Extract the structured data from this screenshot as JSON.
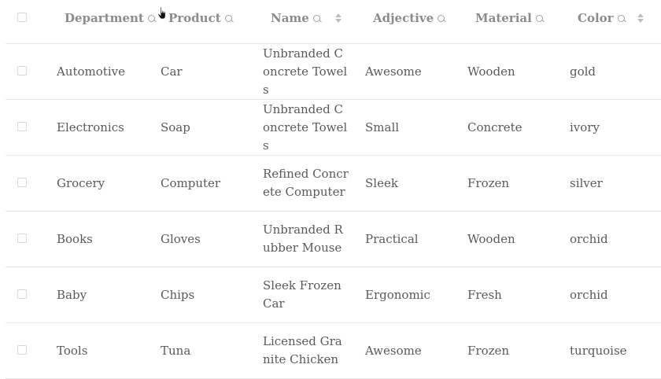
{
  "header": {
    "columns": [
      {
        "key": "department",
        "label": "Department",
        "searchable": true,
        "sortable": false
      },
      {
        "key": "product",
        "label": "Product",
        "searchable": true,
        "sortable": false
      },
      {
        "key": "name",
        "label": "Name",
        "searchable": true,
        "sortable": true
      },
      {
        "key": "adjective",
        "label": "Adjective",
        "searchable": true,
        "sortable": false
      },
      {
        "key": "material",
        "label": "Material",
        "searchable": true,
        "sortable": false
      },
      {
        "key": "color",
        "label": "Color",
        "searchable": true,
        "sortable": true
      }
    ]
  },
  "rows": [
    {
      "department": "Automotive",
      "product": "Car",
      "name": "Unbranded Concrete Towels",
      "adjective": "Awesome",
      "material": "Wooden",
      "color": "gold"
    },
    {
      "department": "Electronics",
      "product": "Soap",
      "name": "Unbranded Concrete Towels",
      "adjective": "Small",
      "material": "Concrete",
      "color": "ivory"
    },
    {
      "department": "Grocery",
      "product": "Computer",
      "name": "Refined Concrete Computer",
      "adjective": "Sleek",
      "material": "Frozen",
      "color": "silver"
    },
    {
      "department": "Books",
      "product": "Gloves",
      "name": "Unbranded Rubber Mouse",
      "adjective": "Practical",
      "material": "Wooden",
      "color": "orchid"
    },
    {
      "department": "Baby",
      "product": "Chips",
      "name": "Sleek Frozen Car",
      "adjective": "Ergonomic",
      "material": "Fresh",
      "color": "orchid"
    },
    {
      "department": "Tools",
      "product": "Tuna",
      "name": "Licensed Granite Chicken",
      "adjective": "Awesome",
      "material": "Frozen",
      "color": "turquoise"
    }
  ],
  "icons": {
    "search": "search-icon",
    "sort": "sort-icon",
    "cursor": "hand-cursor-icon"
  }
}
